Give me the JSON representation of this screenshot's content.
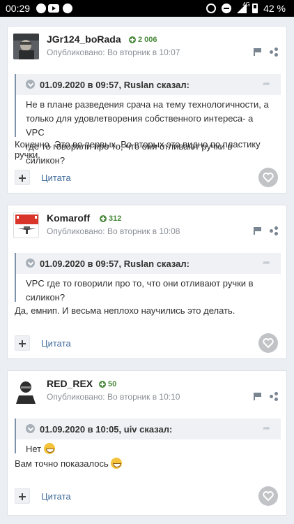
{
  "statusbar": {
    "time": "00:29",
    "battery": "42 %",
    "network": "4G"
  },
  "posts": [
    {
      "author": "JGr124_boRada",
      "reputation": "2 006",
      "published": "Опубликовано: Во вторник в 10:07",
      "quote_title": "01.09.2020 в 09:57, Ruslan сказал:",
      "quote_lines": [
        "Не в плане разведения срача на тему технологичности, а",
        "только для удовлетворения собственного интереса- а VPC",
        "где то говорили про то, что они отливают ручки в силикон?"
      ],
      "body": "Конечно. Это во первых. Во вторых это видно по пластику ручки.",
      "cite": "Цитата"
    },
    {
      "author": "Komaroff",
      "reputation": "312",
      "published": "Опубликовано: Во вторник в 10:08",
      "quote_title": "01.09.2020 в 09:57, Ruslan сказал:",
      "quote_lines": [
        "VPC где то говорили про то, что они отливают ручки в",
        "силикон?"
      ],
      "body": "Да, емнип. И весьма неплохо научились это делать.",
      "cite": "Цитата"
    },
    {
      "author": "RED_REX",
      "reputation": "50",
      "published": "Опубликовано: Во вторник в 10:10",
      "quote_title": "01.09.2020 в 10:05, uiv сказал:",
      "quote_lines": [
        "Нет"
      ],
      "body": "Вам точно показалось",
      "cite": "Цитата"
    }
  ]
}
